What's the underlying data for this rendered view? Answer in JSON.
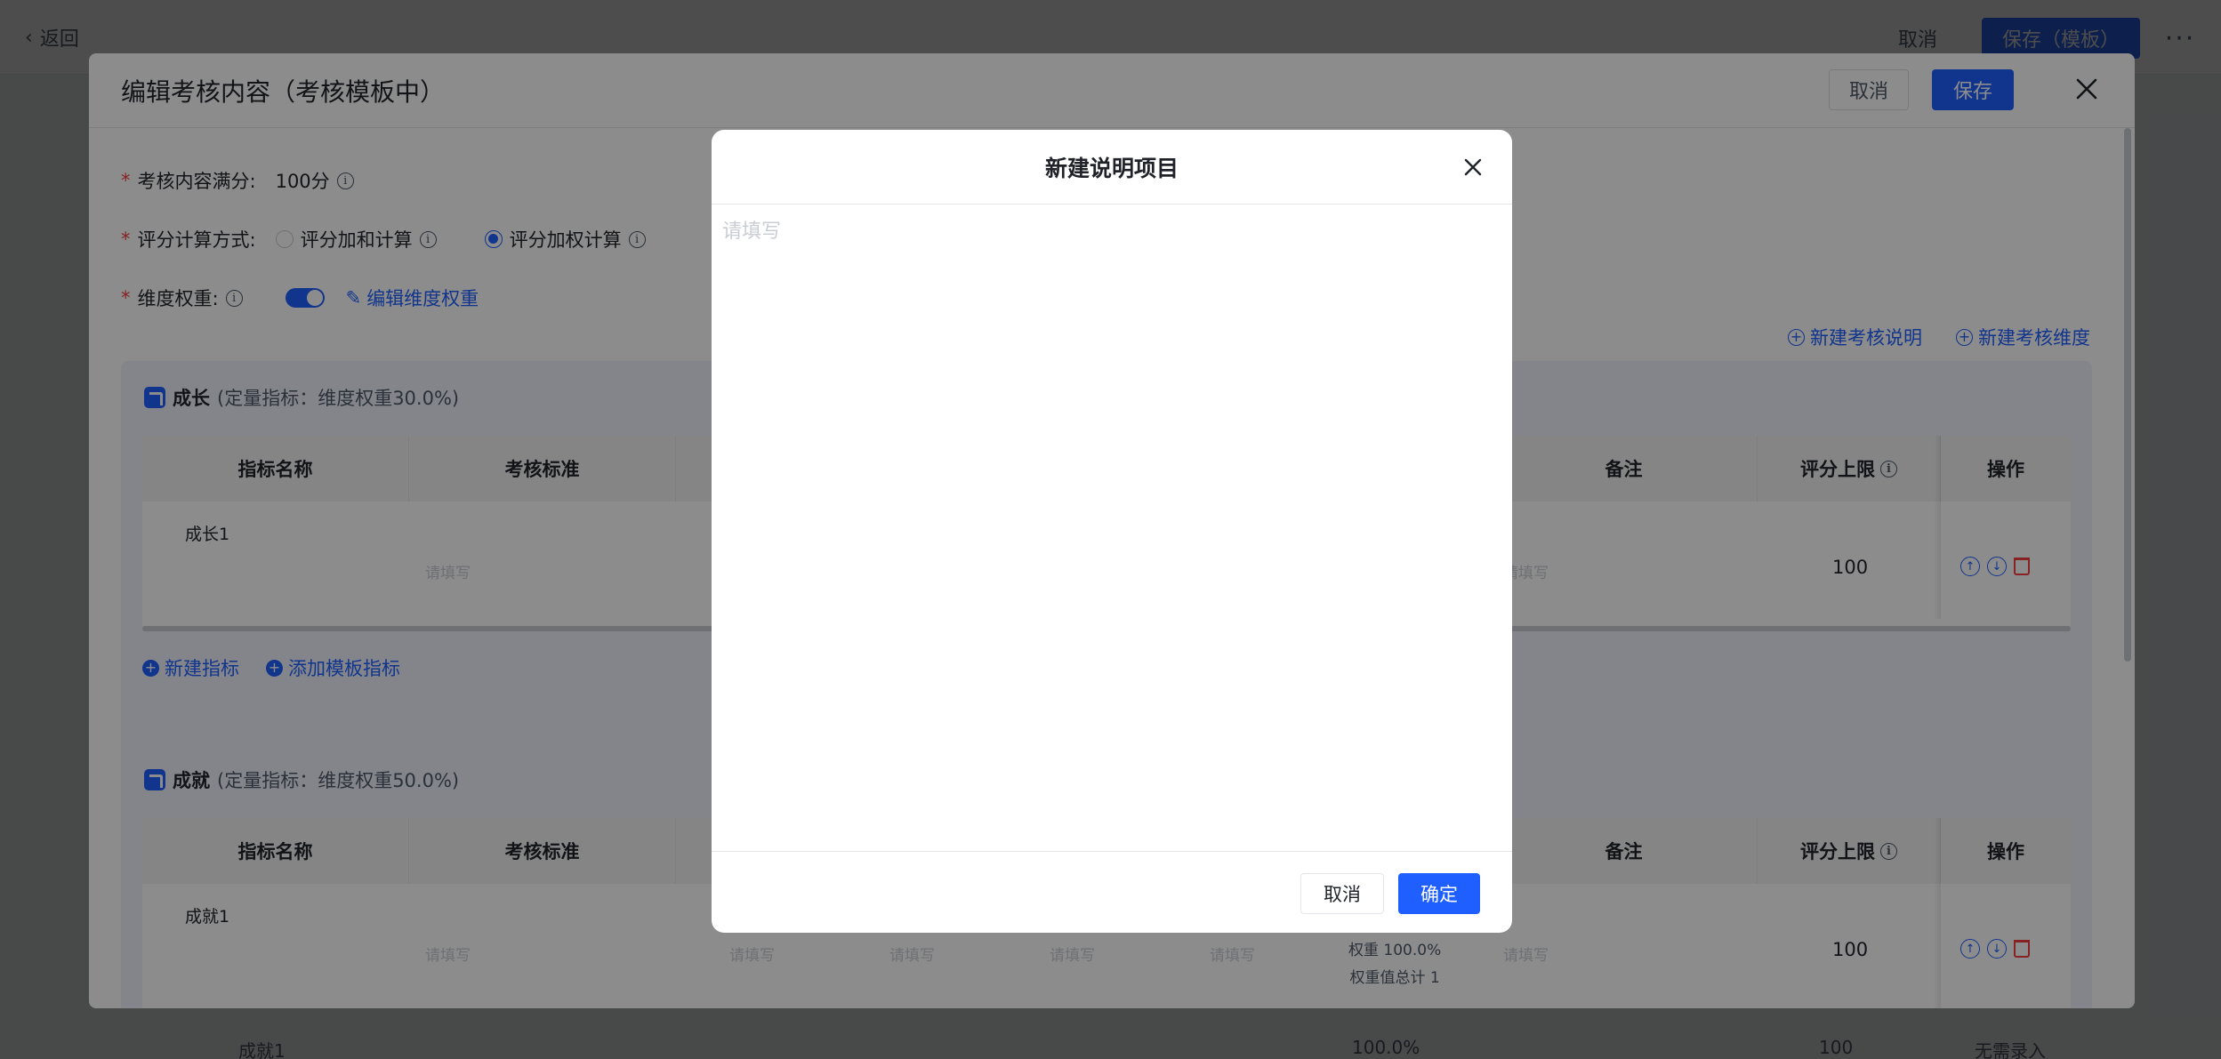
{
  "page": {
    "back_label": "返回",
    "cancel_label": "取消",
    "save_template_label": "保存（模板）",
    "more_label": "···",
    "bg_row": {
      "name": "成就1",
      "weight": "100.0%",
      "limit": "100",
      "status": "无需录入"
    }
  },
  "drawer": {
    "title": "编辑考核内容（考核模板中）",
    "cancel_label": "取消",
    "save_label": "保存",
    "full_score_label": "考核内容满分:",
    "full_score_value": "100分",
    "calc_label": "评分计算方式:",
    "calc_options": [
      "评分加和计算",
      "评分加权计算"
    ],
    "calc_selected": "评分加权计算",
    "weight_label": "维度权重:",
    "weight_toggle_on": true,
    "edit_weight_label": "编辑维度权重",
    "add_desc_label": "新建考核说明",
    "add_dimension_label": "新建考核维度",
    "sections": [
      {
        "name": "成长",
        "meta": "(定量指标：维度权重30.0%)",
        "headers": [
          "指标名称",
          "考核标准",
          "备注",
          "评分上限",
          "操作"
        ],
        "rows": [
          {
            "name": "成长1",
            "standard_placeholder": "请填写",
            "note_placeholder": "请填写",
            "limit": "100"
          }
        ],
        "add_indicator_label": "新建指标",
        "add_template_indicator_label": "添加模板指标"
      },
      {
        "name": "成就",
        "meta": "(定量指标：维度权重50.0%)",
        "headers": [
          "指标名称",
          "考核标准",
          "备注",
          "评分上限",
          "操作"
        ],
        "rows": [
          {
            "name": "成就1",
            "standard_placeholder": "请填写",
            "extra_placeholders": [
              "请填写",
              "请填写",
              "请填写",
              "请填写"
            ],
            "weight_line1": "权重 100.0%",
            "weight_line2": "权重值总计 1",
            "note_placeholder": "请填写",
            "limit": "100"
          }
        ]
      }
    ]
  },
  "dialog": {
    "title": "新建说明项目",
    "textarea_placeholder": "请填写",
    "cancel_label": "取消",
    "ok_label": "确定"
  },
  "colors": {
    "primary": "#1f5fff",
    "danger": "#f53f3f",
    "section_bg": "#eef3fe"
  }
}
